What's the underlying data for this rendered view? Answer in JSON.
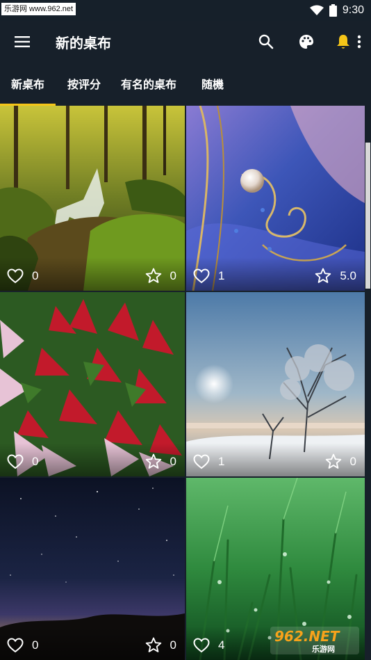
{
  "status_bar": {
    "watermark_text": "乐游网 www.962.net",
    "time": "9:30",
    "icons": [
      "wifi-icon",
      "battery-icon"
    ]
  },
  "app_bar": {
    "title": "新的桌布",
    "icons": [
      "menu-icon",
      "search-icon",
      "palette-icon",
      "bell-icon",
      "more-vert-icon"
    ],
    "accent_color": "#f5c518"
  },
  "tabs": [
    {
      "label": "新桌布",
      "selected": true
    },
    {
      "label": "按评分",
      "selected": false
    },
    {
      "label": "有名的桌布",
      "selected": false
    },
    {
      "label": "随機",
      "selected": false
    }
  ],
  "wallpapers": [
    {
      "subject": "forest-waterfall",
      "likes": "0",
      "rating": "0"
    },
    {
      "subject": "pearl-abstract",
      "likes": "1",
      "rating": "5.0"
    },
    {
      "subject": "poinsettia-flowers",
      "likes": "0",
      "rating": "0"
    },
    {
      "subject": "winter-tree-sunset",
      "likes": "1",
      "rating": "0"
    },
    {
      "subject": "night-sky-stars",
      "likes": "0",
      "rating": "0"
    },
    {
      "subject": "green-grass-dew",
      "likes": "4",
      "rating": ""
    }
  ],
  "watermark": {
    "logo": "962.NET",
    "sub": "乐游网"
  }
}
